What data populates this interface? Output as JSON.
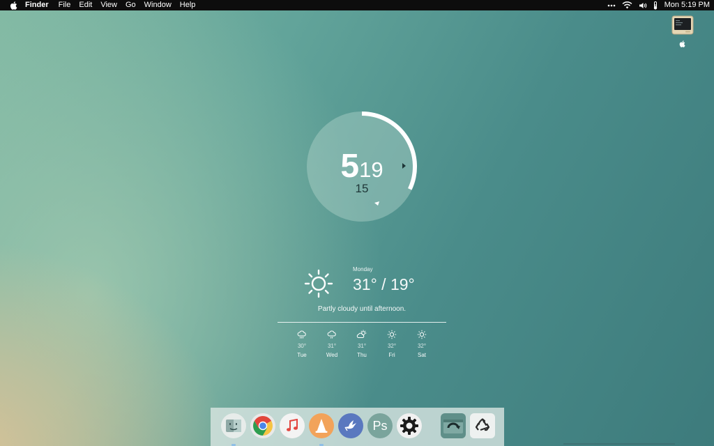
{
  "menubar": {
    "app_name": "Finder",
    "menus": [
      "File",
      "Edit",
      "View",
      "Go",
      "Window",
      "Help"
    ],
    "status_icons": [
      "more-icon",
      "wifi-icon",
      "volume-icon",
      "thermometer-icon"
    ],
    "clock": "Mon 5:19 PM"
  },
  "desktop": {
    "icons": [
      {
        "name": "computer-icon"
      }
    ]
  },
  "clock_widget": {
    "hour": "5",
    "minute": "19",
    "seconds": "15",
    "progress": 0.32,
    "ring_color": "#ffffff"
  },
  "weather": {
    "day": "Monday",
    "temperature": "31° / 19°",
    "summary": "Partly cloudy until afternoon.",
    "current_icon": "sun-icon",
    "forecast": [
      {
        "day": "Tue",
        "temp": "30°",
        "icon": "rain-cloud-icon"
      },
      {
        "day": "Wed",
        "temp": "31°",
        "icon": "rain-cloud-icon"
      },
      {
        "day": "Thu",
        "temp": "31°",
        "icon": "partly-cloudy-icon"
      },
      {
        "day": "Fri",
        "temp": "32°",
        "icon": "sun-icon"
      },
      {
        "day": "Sat",
        "temp": "32°",
        "icon": "sun-icon"
      }
    ]
  },
  "dock": {
    "apps": [
      {
        "name": "finder",
        "running": true,
        "color": "#e7ecea"
      },
      {
        "name": "chrome",
        "running": false,
        "color": "#e9e9e9"
      },
      {
        "name": "music",
        "running": false,
        "color": "#f3f3f3"
      },
      {
        "name": "vlc",
        "running": true,
        "color": "#f2a35a"
      },
      {
        "name": "mail",
        "running": false,
        "color": "#5a78bf"
      },
      {
        "name": "photoshop",
        "running": false,
        "color": "#7aa49c"
      },
      {
        "name": "settings",
        "running": false,
        "color": "#f1f1f1"
      },
      {
        "name": "time-machine",
        "running": false,
        "color": "#5f8f89"
      },
      {
        "name": "trash",
        "running": false,
        "color": "#eef1f0"
      }
    ],
    "ps_label": "Ps"
  }
}
